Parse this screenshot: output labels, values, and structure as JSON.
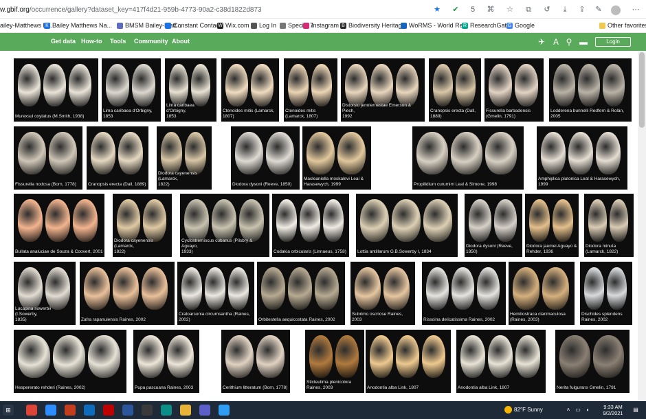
{
  "browser": {
    "url_host": "w.gbif.org",
    "url_path": "/occurrence/gallery?dataset_key=417f4d21-959b-4773-90a2-c38d1822d873",
    "toolbar_badge": "5"
  },
  "bookmarks": {
    "items": [
      {
        "label": "ailey-Matthews N...",
        "color": "#6b6b6b"
      },
      {
        "label": "Bailey Matthews Na...",
        "color": "#1a73e8",
        "icon": "K"
      },
      {
        "label": "BMSM Bailey-Matt...",
        "color": "#5c6bc0"
      },
      {
        "label": "Constant Contact",
        "color": "#1a73e8"
      },
      {
        "label": "Wix.com",
        "color": "#222222",
        "icon": "W"
      },
      {
        "label": "Log In",
        "color": "#555555"
      },
      {
        "label": "Specify 7",
        "color": "#777777"
      },
      {
        "label": "Instagram",
        "color": "#d62976"
      },
      {
        "label": "Biodiversity Heritag...",
        "color": "#2b2b2b",
        "icon": "B"
      },
      {
        "label": "WoRMS - World Re...",
        "color": "#1565c0"
      },
      {
        "label": "ResearchGate",
        "color": "#00a88f",
        "icon": "R"
      },
      {
        "label": "Google",
        "color": "#4285f4",
        "icon": "G"
      },
      {
        "label": "Other favorites",
        "color": "#f2c94c"
      }
    ]
  },
  "site_nav": {
    "links": [
      "Get data",
      "How-to",
      "Tools",
      "Community",
      "About"
    ],
    "login": "Login"
  },
  "gallery": {
    "rows": [
      [
        {
          "caption": "Murexsul oxytatus (M.Smith, 1938)",
          "shell": "#e9e3d8"
        },
        {
          "caption": "Lima caribaea d'Orbigny,\n1853",
          "shell": "#dcd8cf"
        },
        {
          "caption": "Lima caribaea d'Orbigny,\n1853",
          "shell": "#e7e1d2"
        },
        {
          "caption": "Ctenoides mitis (Lamarck,\n1807)",
          "shell": "#f0dcc0"
        },
        {
          "caption": "Ctenoides mitis\n(Lamarck, 1807)",
          "shell": "#ecd5b5"
        },
        {
          "caption": "Distorsio jenniernestae Emerson & Piech,\n1992",
          "shell": "#e8d6bd"
        },
        {
          "caption": "Cranopsis erecta (Dall,\n1889)",
          "shell": "#d9c7a8"
        },
        {
          "caption": "Fissurella barbadensis\n(Gmelin, 1791)",
          "shell": "#e2d3c4"
        },
        {
          "caption": "Lodderena bunnelli Redfern & Rolán, 2005",
          "shell": "#b9b2a6"
        }
      ],
      [
        {
          "caption": "Fissurella nodosa (Born, 1778)",
          "shell": "#cfc6b7"
        },
        {
          "caption": "Cranopsis erecta (Dall, 1889)",
          "shell": "#e5d8c1"
        },
        {
          "caption": "Diodora cayenensis (Lamarck,\n1822)",
          "shell": "#d8c6a6"
        },
        {
          "caption": "Diodora dysoni (Reeve, 1850)",
          "shell": "#dedad3"
        },
        {
          "caption": "Macleaniella moskalevi Leal & Harasewych, 1999",
          "shell": "#e1c79c"
        },
        {
          "caption": "Propilidium curumim Leal & Simone, 1998",
          "shell": "#d7cfc2"
        },
        {
          "caption": "Amphiplica plutonica Leal & Harasewych, 1999",
          "shell": "#e4ddd2"
        }
      ],
      [
        {
          "caption": "Bullata analuciae de Souza & Coovert, 2001",
          "shell": "#f2b48e"
        },
        {
          "caption": "Diodora cayenensis (Lamarck,\n1822)",
          "shell": "#dfc9a4"
        },
        {
          "caption": "Cyclostremiscus cubanus (Pilsbry & Aguayo,\n1933)",
          "shell": "#c8c2b0"
        },
        {
          "caption": "Codakia orbicularis (Linnaeus, 1758)",
          "shell": "#f0ece4"
        },
        {
          "caption": "Lottia antillarum G.B.Sowerby I, 1834",
          "shell": "#dccfb4"
        },
        {
          "caption": "Diodora dysoni (Reeve,\n1850)",
          "shell": "#d6d0c8"
        },
        {
          "caption": "Diodora jaumei Aguayo &\nRehder, 1936",
          "shell": "#e3bf8c"
        },
        {
          "caption": "Diodora minuta\n(Lamarck, 1822)",
          "shell": "#d9cbb4"
        }
      ],
      [
        {
          "caption": "Lucapina sowerbii (I.Sowerby,\n1835)",
          "shell": "#e2dcd2"
        },
        {
          "caption": "Zafra rapanuiensis Raines, 2002",
          "shell": "#e9c09a"
        },
        {
          "caption": "Cratoarsonia circumsantha (Raines,\n2002)",
          "shell": "#ebe8e1"
        },
        {
          "caption": "Orbitestella aequicostata Raines, 2002",
          "shell": "#b7aa92"
        },
        {
          "caption": "Subrimo oscriose Raines, 2003",
          "shell": "#e6c6a0"
        },
        {
          "caption": "Rissoina delicatissima Raines, 2002",
          "shell": "#e6e4e0"
        },
        {
          "caption": "Hemiliostraca clarimaculosa\n(Raines, 2003)",
          "shell": "#d5b07e"
        },
        {
          "caption": "Dischides splendens\nRaines, 2002",
          "shell": "#d8dadc"
        }
      ],
      [
        {
          "caption": "Hespererato rehderi (Raines, 2002)",
          "shell": "#e6e2d6"
        },
        {
          "caption": "Pupa pascuana Raines, 2003",
          "shell": "#ece5d8"
        },
        {
          "caption": "Cerithium litteratum (Born, 1778)",
          "shell": "#e0d2c2"
        },
        {
          "caption": "Sticteulima plenicolora\nRaines, 2003",
          "shell": "#b07a3e"
        },
        {
          "caption": "Anodontia alba Link, 1807",
          "shell": "#eec98f"
        },
        {
          "caption": "Anodontia alba Link, 1807",
          "shell": "#e8e3d6"
        },
        {
          "caption": "Nerita fulgurans Gmelin, 1791",
          "shell": "#8a7f73"
        }
      ]
    ]
  },
  "taskbar": {
    "apps": [
      {
        "name": "chrome-icon",
        "color": "#db4437"
      },
      {
        "name": "zoom-icon",
        "color": "#2d8cff"
      },
      {
        "name": "powerpoint-icon",
        "color": "#c43e1c"
      },
      {
        "name": "onedrive-icon",
        "color": "#0f6cbd"
      },
      {
        "name": "filezilla-icon",
        "color": "#bf0000"
      },
      {
        "name": "word-icon",
        "color": "#2b579a"
      },
      {
        "name": "calculator-icon",
        "color": "#3a3a3a"
      },
      {
        "name": "edge-icon",
        "color": "#0c8f86"
      },
      {
        "name": "explorer-icon",
        "color": "#e8b339"
      },
      {
        "name": "teams-icon",
        "color": "#5b5fc7"
      },
      {
        "name": "wps-icon",
        "color": "#2f9df4"
      }
    ],
    "weather": "82°F  Sunny",
    "time": "9:33 AM",
    "date": "9/2/2021"
  }
}
